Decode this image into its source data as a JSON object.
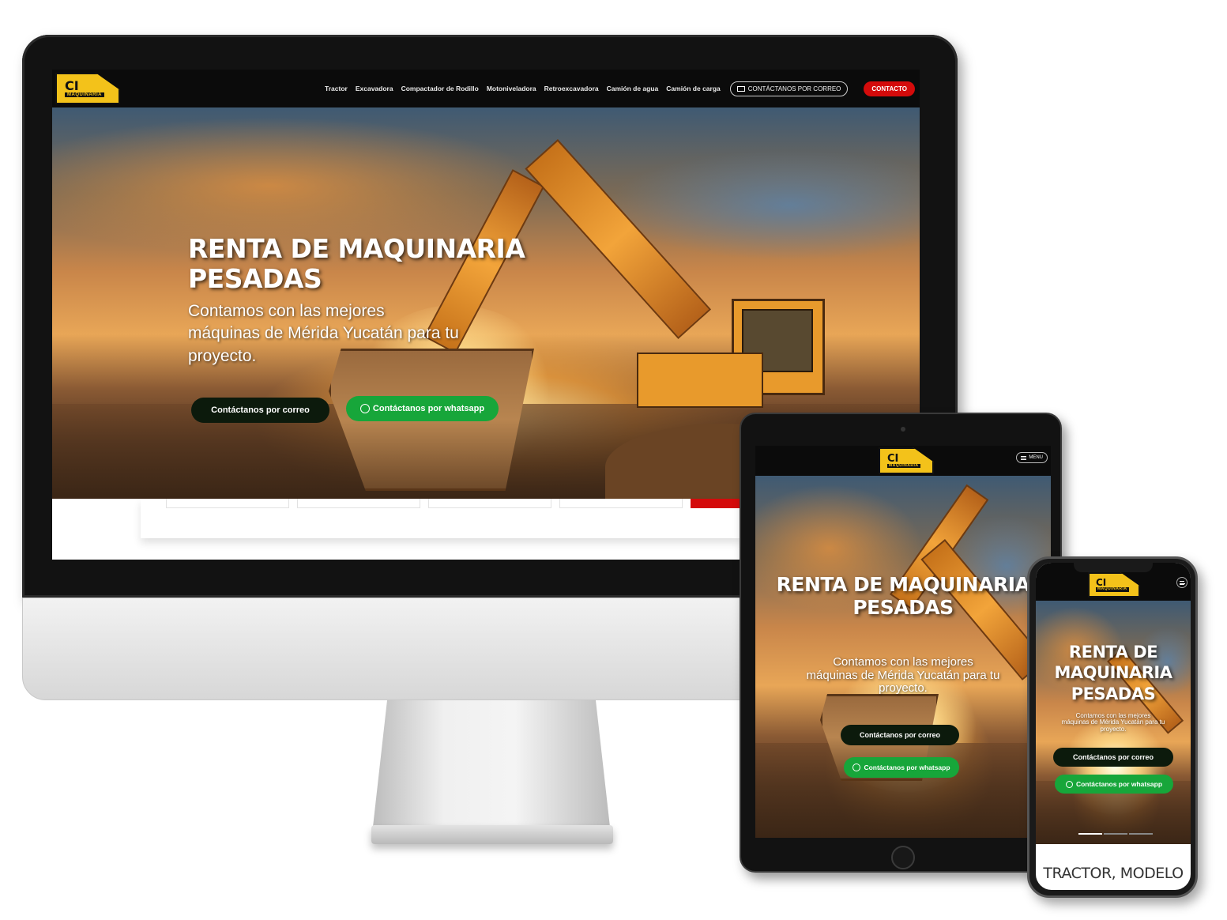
{
  "brand": {
    "logo_main": "CI",
    "logo_sub": "MAQUINARIA",
    "accent": "#f3c21a",
    "red": "#d40b0b",
    "green": "#17a63a"
  },
  "desktop": {
    "nav_links": [
      "Tractor",
      "Excavadora",
      "Compactador de Rodillo",
      "Motoniveladora",
      "Retroexcavadora",
      "Camión de agua",
      "Camión de carga"
    ],
    "mail_button": "CONTÁCTANOS POR CORREO",
    "contact_button": "CONTACTO",
    "hero_title_line1": "RENTA DE MAQUINARIA",
    "hero_title_line2": "PESADAS",
    "hero_sub_line1": "Contamos con las mejores",
    "hero_sub_line2": "máquinas de Mérida Yucatán para tu",
    "hero_sub_line3": "proyecto.",
    "btn_mail": "Contáctanos por correo",
    "btn_whatsapp": "Contáctanos por whatsapp"
  },
  "tablet": {
    "menu_label": "MENU",
    "hero_title_line1": "RENTA DE MAQUINARIA",
    "hero_title_line2": "PESADAS",
    "hero_sub_line1": "Contamos con las mejores",
    "hero_sub_line2": "máquinas de Mérida Yucatán para tu",
    "hero_sub_line3": "proyecto.",
    "btn_mail": "Contáctanos por correo",
    "btn_whatsapp": "Contáctanos por whatsapp"
  },
  "phone": {
    "hero_title_line1": "RENTA DE",
    "hero_title_line2": "MAQUINARIA",
    "hero_title_line3": "PESADAS",
    "hero_sub_line1": "Contamos con las mejores",
    "hero_sub_line2": "máquinas de Mérida Yucatán para tu",
    "hero_sub_line3": "proyecto.",
    "btn_mail": "Contáctanos por correo",
    "btn_whatsapp": "Contáctanos por whatsapp",
    "section_title": "TRACTOR, MODELO"
  }
}
